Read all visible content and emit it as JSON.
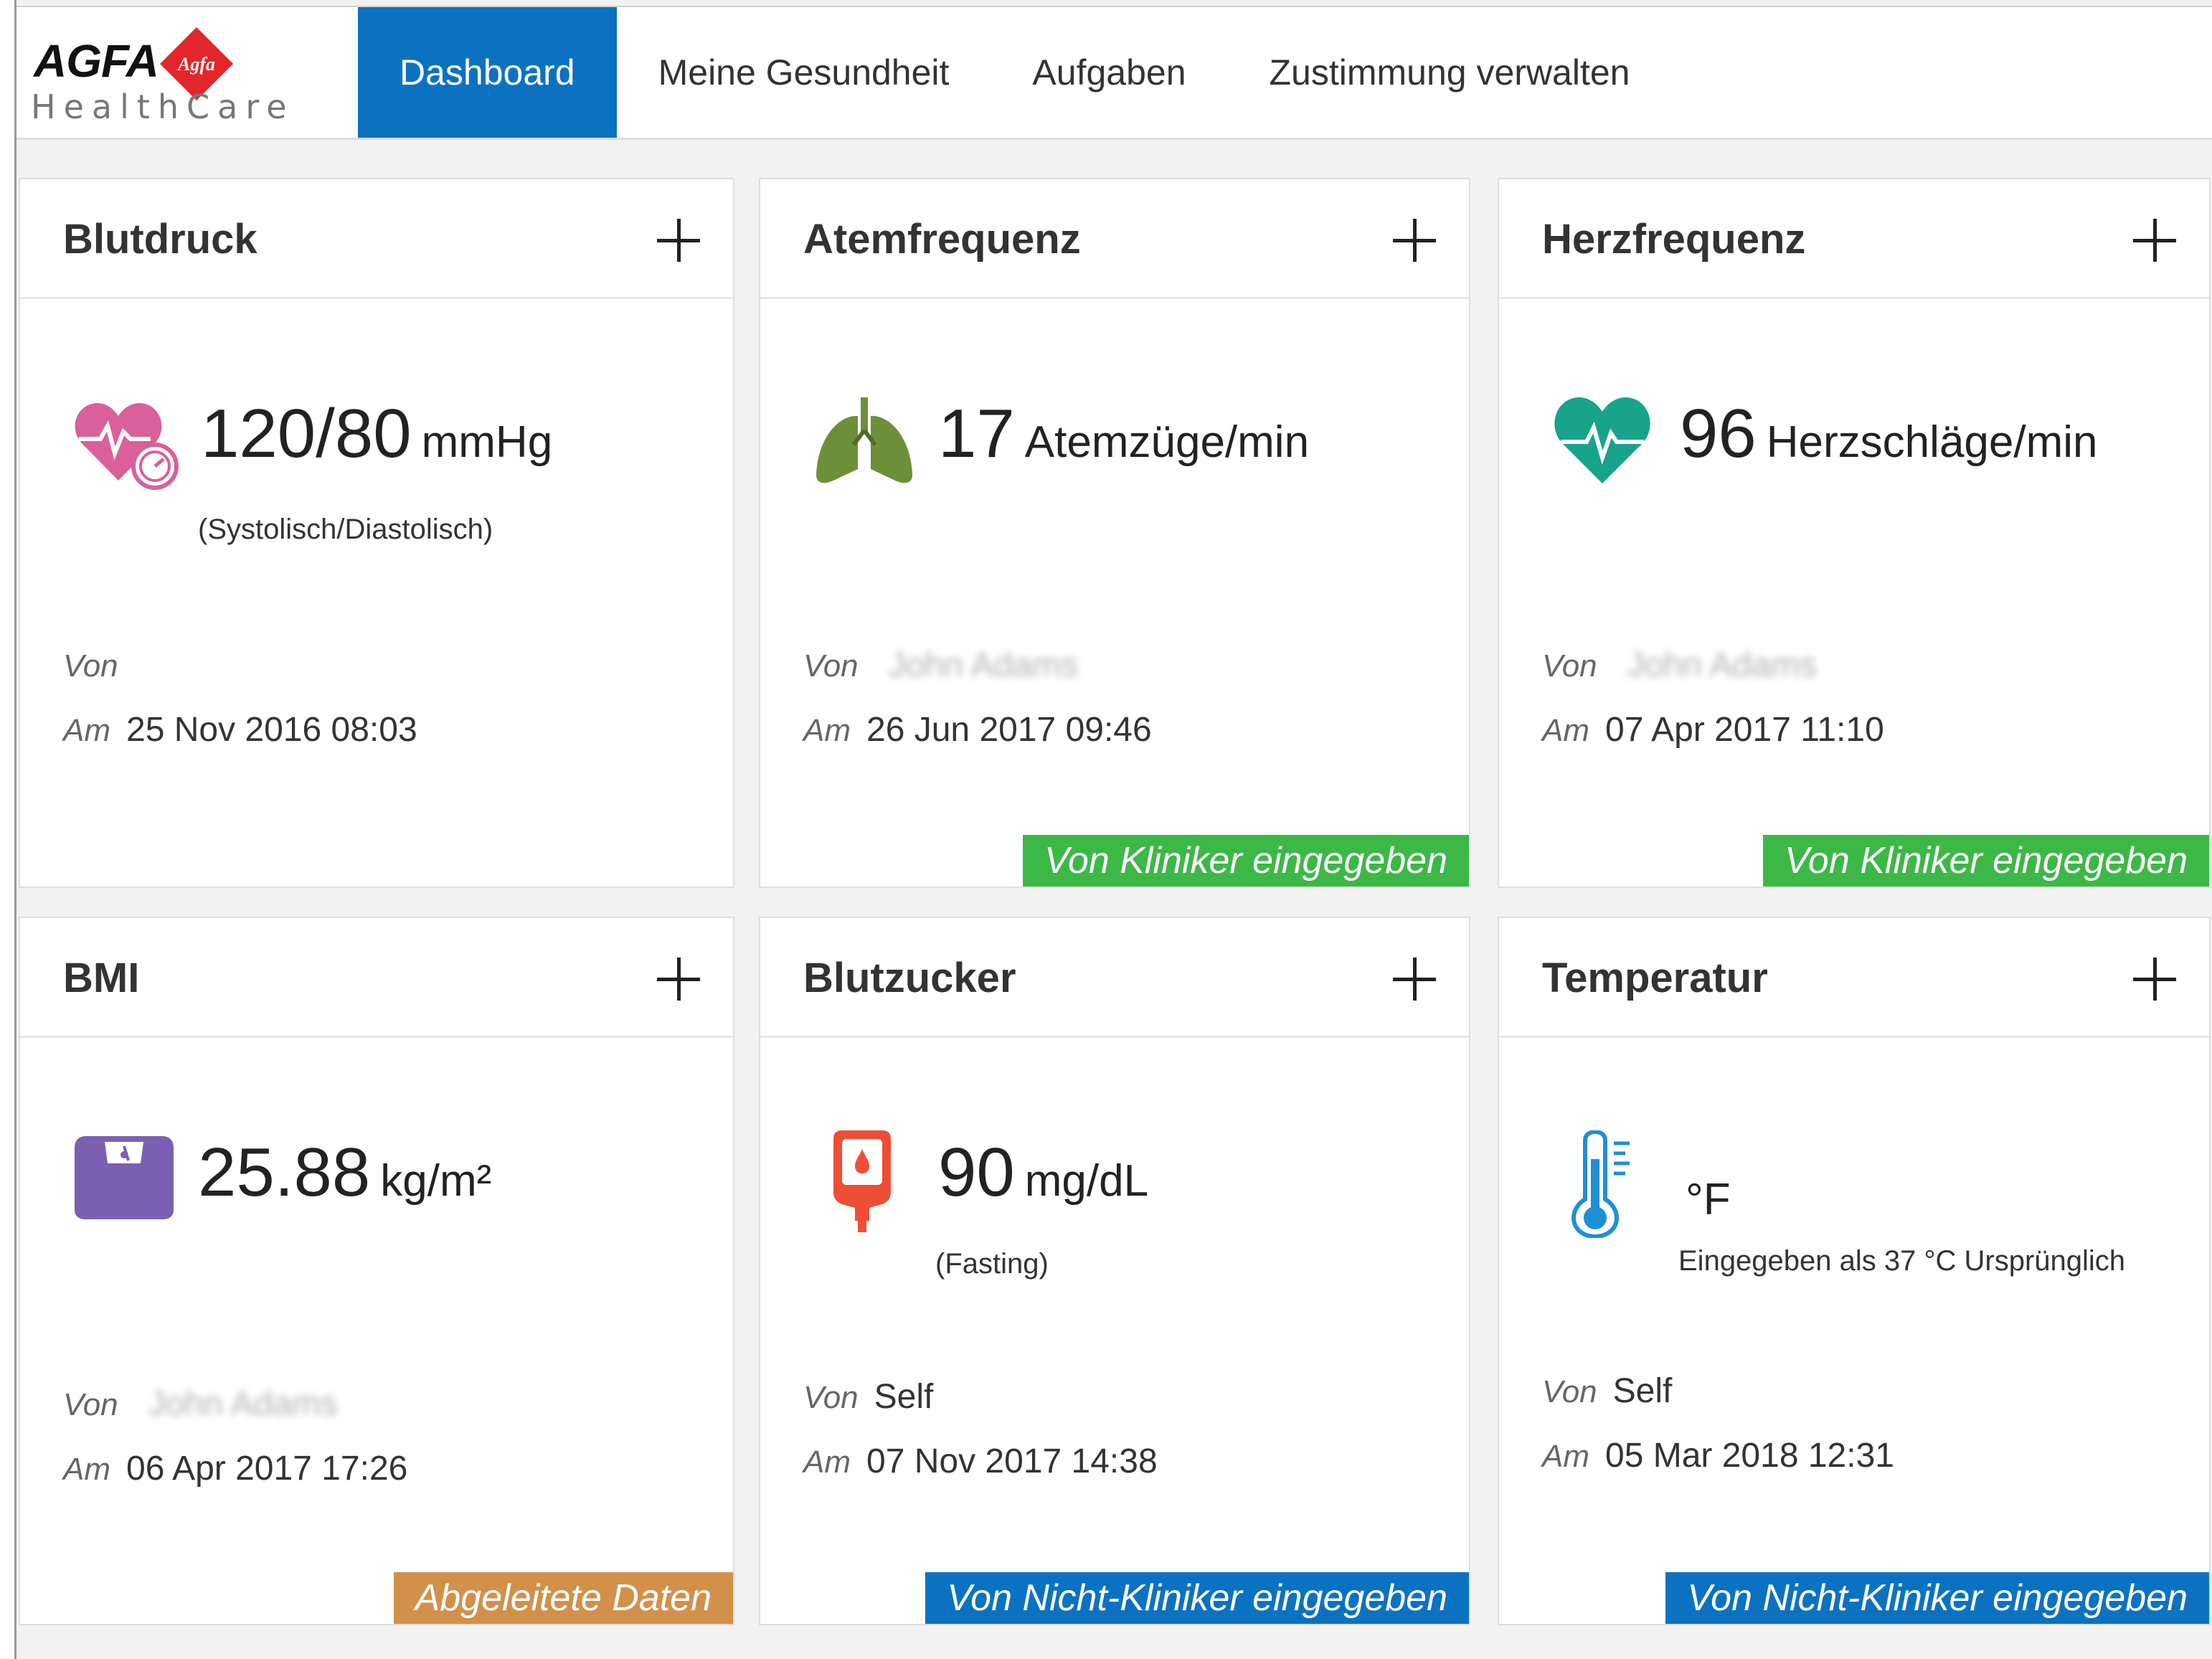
{
  "logo": {
    "brand": "AGFA",
    "diamond_text": "Agfa",
    "subtitle": "HealthCare",
    "brand_color": "#e3262b"
  },
  "nav": {
    "tabs": [
      {
        "label": "Dashboard",
        "active": true
      },
      {
        "label": "Meine Gesundheit",
        "active": false
      },
      {
        "label": "Aufgaben",
        "active": false
      },
      {
        "label": "Zustimmung verwalten",
        "active": false
      }
    ],
    "active_color": "#0b72c1"
  },
  "labels": {
    "von": "Von",
    "am": "Am"
  },
  "cards": [
    {
      "title": "Blutdruck",
      "icon": "heart-pressure-icon",
      "value": "120/80",
      "unit": "mmHg",
      "note": "(Systolisch/Diastolisch)",
      "von": "",
      "am": "25 Nov 2016 08:03",
      "badge": ""
    },
    {
      "title": "Atemfrequenz",
      "icon": "lungs-icon",
      "value": "17",
      "unit": "Atemzüge/min",
      "note": "",
      "von": "John Adams",
      "am": "26 Jun 2017 09:46",
      "badge": "Von Kliniker eingegeben",
      "badge_color": "#3cb846"
    },
    {
      "title": "Herzfrequenz",
      "icon": "heart-pulse-icon",
      "value": "96",
      "unit": "Herzschläge/min",
      "note": "",
      "von": "John Adams",
      "am": "07 Apr 2017 11:10",
      "badge": "Von Kliniker eingegeben",
      "badge_color": "#3cb846"
    },
    {
      "title": "BMI",
      "icon": "scale-icon",
      "value": "25.88",
      "unit": "kg/m²",
      "note": "",
      "von": "John Adams",
      "am": "06 Apr 2017 17:26",
      "badge": "Abgeleitete Daten",
      "badge_color": "#d3904a"
    },
    {
      "title": "Blutzucker",
      "icon": "glucose-meter-icon",
      "value": "90",
      "unit": "mg/dL",
      "note": "(Fasting)",
      "von": "Self",
      "am": "07 Nov 2017 14:38",
      "badge": "Von Nicht-Kliniker eingegeben",
      "badge_color": "#0b72c1"
    },
    {
      "title": "Temperatur",
      "icon": "thermometer-icon",
      "value": "",
      "unit": "°F",
      "note": "Eingegeben als 37 °C Ursprünglich",
      "von": "Self",
      "am": "05 Mar 2018 12:31",
      "badge": "Von Nicht-Kliniker eingegeben",
      "badge_color": "#0b72c1"
    }
  ],
  "icon_colors": {
    "heart_pressure": "#d9609a",
    "lungs": "#6e8f3a",
    "heart_pulse": "#18a38b",
    "scale": "#7b5fb3",
    "glucose": "#ee4e36",
    "thermometer": "#1f8fd6"
  }
}
